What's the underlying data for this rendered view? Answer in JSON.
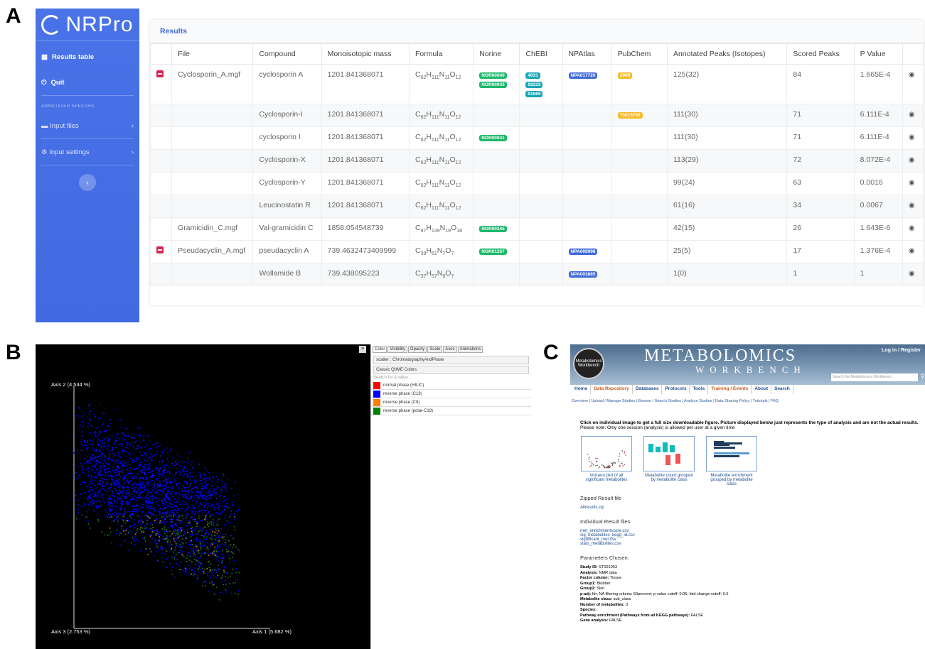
{
  "panel_letters": {
    "a": "A",
    "b": "B",
    "c": "C"
  },
  "nrpro": {
    "logo_text": "NRPro",
    "sidebar": {
      "results_table": "Results table",
      "quit": "Quit",
      "section_header": "ANNOTATED SPECTRA",
      "input_files": "Input files",
      "input_settings": "Input settings"
    },
    "results_title": "Results",
    "columns": [
      "File",
      "Compound",
      "Monoisotopic mass",
      "Formula",
      "Norine",
      "ChEBI",
      "NPAtlas",
      "PubChem",
      "Annotated Peaks (Isotopes)",
      "Scored Peaks",
      "P Value"
    ],
    "rows": [
      {
        "file": "Cyclosporin_A.mgf",
        "compound": "cyclosporin A",
        "mass": "1201.841368071",
        "formula": [
          "C",
          "62",
          "H",
          "111",
          "N",
          "11",
          "O",
          "12"
        ],
        "norine": [
          "NOR00040",
          "NOR00033"
        ],
        "chebi": [
          "4031",
          "92233",
          "91669"
        ],
        "npatlas": [
          "NPA017720"
        ],
        "pubchem": [
          "2909"
        ],
        "peaks": "125(32)",
        "scored": "84",
        "p": "1.665E-4"
      },
      {
        "file": "",
        "compound": "Cyclosporin-I",
        "mass": "1201.841368071",
        "formula": [
          "C",
          "62",
          "H",
          "111",
          "N",
          "11",
          "O",
          "12"
        ],
        "norine": [],
        "chebi": [],
        "npatlas": [],
        "pubchem": [
          "75015793"
        ],
        "peaks": "111(30)",
        "scored": "71",
        "p": "6.111E-4"
      },
      {
        "file": "",
        "compound": "cyclosporin I",
        "mass": "1201.841368071",
        "formula": [
          "C",
          "62",
          "H",
          "111",
          "N",
          "11",
          "O",
          "12"
        ],
        "norine": [
          "NOR00041"
        ],
        "chebi": [],
        "npatlas": [],
        "pubchem": [],
        "peaks": "111(30)",
        "scored": "71",
        "p": "6.111E-4"
      },
      {
        "file": "",
        "compound": "Cyclosporin-X",
        "mass": "1201.841368071",
        "formula": [
          "C",
          "62",
          "H",
          "111",
          "N",
          "11",
          "O",
          "12"
        ],
        "norine": [],
        "chebi": [],
        "npatlas": [],
        "pubchem": [],
        "peaks": "113(29)",
        "scored": "72",
        "p": "8.072E-4"
      },
      {
        "file": "",
        "compound": "Cyclosporin-Y",
        "mass": "1201.841368071",
        "formula": [
          "C",
          "62",
          "H",
          "111",
          "N",
          "11",
          "O",
          "12"
        ],
        "norine": [],
        "chebi": [],
        "npatlas": [],
        "pubchem": [],
        "peaks": "99(24)",
        "scored": "63",
        "p": "0.0016"
      },
      {
        "file": "",
        "compound": "Leucinostatin R",
        "mass": "1201.841368071",
        "formula": [
          "C",
          "62",
          "H",
          "111",
          "N",
          "11",
          "O",
          "12"
        ],
        "norine": [],
        "chebi": [],
        "npatlas": [],
        "pubchem": [],
        "peaks": "61(16)",
        "scored": "34",
        "p": "0.0067"
      },
      {
        "file": "Gramicidin_C.mgf",
        "compound": "Val-gramicidin C",
        "mass": "1858.054548739",
        "formula": [
          "C",
          "97",
          "H",
          "139",
          "N",
          "19",
          "O",
          "18"
        ],
        "norine": [
          "NOR00245"
        ],
        "chebi": [],
        "npatlas": [],
        "pubchem": [],
        "peaks": "42(15)",
        "scored": "26",
        "p": "1.643E-6"
      },
      {
        "file": "Pseudacyclin_A.mgf",
        "compound": "pseudacyclin A",
        "mass": "739.4632473409999",
        "formula": [
          "C",
          "39",
          "H",
          "61",
          "N",
          "7",
          "O",
          "7"
        ],
        "norine": [
          "NOR01267"
        ],
        "chebi": [],
        "npatlas": [
          "NPA008998"
        ],
        "pubchem": [],
        "peaks": "25(5)",
        "scored": "17",
        "p": "1.376E-4"
      },
      {
        "file": "",
        "compound": "Wollamide B",
        "mass": "739.438095223",
        "formula": [
          "C",
          "37",
          "H",
          "57",
          "N",
          "9",
          "O",
          "7"
        ],
        "norine": [],
        "chebi": [],
        "npatlas": [
          "NPA003885"
        ],
        "pubchem": [],
        "peaks": "1(0)",
        "scored": "1",
        "p": "1"
      }
    ],
    "minus_rows": [
      0,
      7
    ],
    "alt_rows": [
      1,
      3,
      5,
      8
    ]
  },
  "emperor": {
    "axis2": "Axis 2 (4.534 %)",
    "axis3": "Axis 3 (2.753 %)",
    "axis1": "Axis 1 (5.682 %)",
    "tabs": [
      "Color",
      "Visibility",
      "Opacity",
      "Scale",
      "Axes",
      "Animations"
    ],
    "scatter_select": "scatter : ChromatographyAndPhase",
    "colormap": "Classic QIIME Colors",
    "search_placeholder": "Search for a value ...",
    "legend": [
      {
        "label": "normal phase (HILIC)",
        "color": "#ff0000"
      },
      {
        "label": "reverse phase (C18)",
        "color": "#0000ff"
      },
      {
        "label": "reverse phase (C8)",
        "color": "#ff7f00"
      },
      {
        "label": "reverse phase (polar-C18)",
        "color": "#008000"
      }
    ]
  },
  "workbench": {
    "title": "METABOLOMICS",
    "subtitle": "WORKBENCH",
    "seal": "Metabolomics Workbench",
    "login": "Log in / Register",
    "search_placeholder": "Search the Metabolomics Workbench",
    "nav": [
      "Home",
      "Data Repository",
      "Databases",
      "Protocols",
      "Tools",
      "Training / Events",
      "About",
      "Search"
    ],
    "subnav": "Overview | Upload / Manage Studies | Browse / Search Studies | Analyze Studies | Data Sharing Policy | Tutorials | FAQ",
    "intro1": "Click on individual image to get a full size downloadable figure. Picture displayed below just represents the type of analysis and are not the actual results.",
    "intro2": "Please note: Only one session (analysis) is allowed per user at a given time",
    "thumbs": [
      {
        "caption": "Volcano plot of all significant metabolites"
      },
      {
        "caption": "Metabolite count grouped by metabolite class"
      },
      {
        "caption": "Metabolite enrichment grouped by metabolite class"
      }
    ],
    "zipped_header": "Zipped Result file",
    "zip_link": "Allresults.zip",
    "individual_header": "Individual Result files",
    "files": [
      "met_enrichmentscore.csv",
      "sig_metabolites_kegg_id.csv",
      "significant_met.csv",
      "stats_metabolites.csv"
    ],
    "params_header": "Parameters Chosen:",
    "params": [
      [
        "Study ID:",
        " ST001053"
      ],
      [
        "Analysis:",
        " NMR data"
      ],
      [
        "Factor column:",
        " Tissue"
      ],
      [
        "Group1:",
        " Blubber"
      ],
      [
        "Group2:",
        " Skin"
      ],
      [
        "p-adj:",
        " fdr; NA filtering criteria: 50percent; p-value cutoff: 0.05; fold change cutoff: 0.5"
      ],
      [
        "Metabolite class:",
        " sub_class"
      ],
      [
        "Number of metabolites:",
        " 3"
      ],
      [
        "Species:",
        ""
      ],
      [
        "Pathway enrichment (Pathways from all KEGG pathways):",
        " FALSE"
      ],
      [
        "Gene analysis:",
        " FALSE"
      ]
    ]
  }
}
